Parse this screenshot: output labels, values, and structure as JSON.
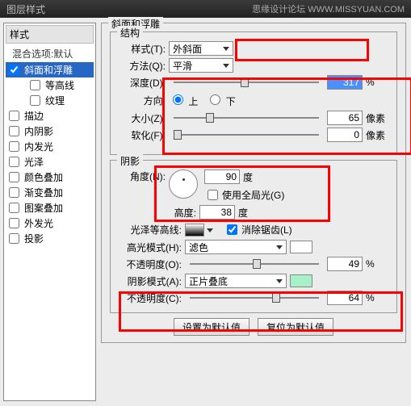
{
  "topbar": {
    "title": "图层样式",
    "brand": "思缘设计论坛 WWW.MISSYUAN.COM"
  },
  "sidebar": {
    "header": "样式",
    "blending": "混合选项:默认",
    "items": [
      {
        "label": "斜面和浮雕",
        "checked": true,
        "selected": true,
        "indent": false
      },
      {
        "label": "等高线",
        "checked": false,
        "selected": false,
        "indent": true
      },
      {
        "label": "纹理",
        "checked": false,
        "selected": false,
        "indent": true
      },
      {
        "label": "描边",
        "checked": false,
        "selected": false,
        "indent": false
      },
      {
        "label": "内阴影",
        "checked": false,
        "selected": false,
        "indent": false
      },
      {
        "label": "内发光",
        "checked": false,
        "selected": false,
        "indent": false
      },
      {
        "label": "光泽",
        "checked": false,
        "selected": false,
        "indent": false
      },
      {
        "label": "颜色叠加",
        "checked": false,
        "selected": false,
        "indent": false
      },
      {
        "label": "渐变叠加",
        "checked": false,
        "selected": false,
        "indent": false
      },
      {
        "label": "图案叠加",
        "checked": false,
        "selected": false,
        "indent": false
      },
      {
        "label": "外发光",
        "checked": false,
        "selected": false,
        "indent": false
      },
      {
        "label": "投影",
        "checked": false,
        "selected": false,
        "indent": false
      }
    ]
  },
  "main": {
    "group_title": "斜面和浮雕",
    "structure": {
      "title": "结构",
      "style_label": "样式(T):",
      "style_value": "外斜面",
      "technique_label": "方法(Q):",
      "technique_value": "平滑",
      "depth_label": "深度(D):",
      "depth_value": "317",
      "depth_unit": "%",
      "direction_label": "方向:",
      "direction_up": "上",
      "direction_down": "下",
      "size_label": "大小(Z):",
      "size_value": "65",
      "size_unit": "像素",
      "soften_label": "软化(F):",
      "soften_value": "0",
      "soften_unit": "像素"
    },
    "shading": {
      "title": "阴影",
      "angle_label": "角度(N):",
      "angle_value": "90",
      "angle_unit": "度",
      "global_label": "使用全局光(G)",
      "altitude_label": "高度:",
      "altitude_value": "38",
      "altitude_unit": "度",
      "gloss_label": "光泽等高线:",
      "antialias_label": "消除锯齿(L)",
      "hl_mode_label": "高光模式(H):",
      "hl_mode_value": "滤色",
      "hl_opacity_label": "不透明度(O):",
      "hl_opacity_value": "49",
      "hl_opacity_unit": "%",
      "sh_mode_label": "阴影模式(A):",
      "sh_mode_value": "正片叠底",
      "sh_opacity_label": "不透明度(C):",
      "sh_opacity_value": "64",
      "sh_opacity_unit": "%"
    },
    "buttons": {
      "reset": "设置为默认值",
      "restore": "复位为默认值"
    },
    "colors": {
      "shadow_swatch": "#a8f0c8"
    }
  }
}
